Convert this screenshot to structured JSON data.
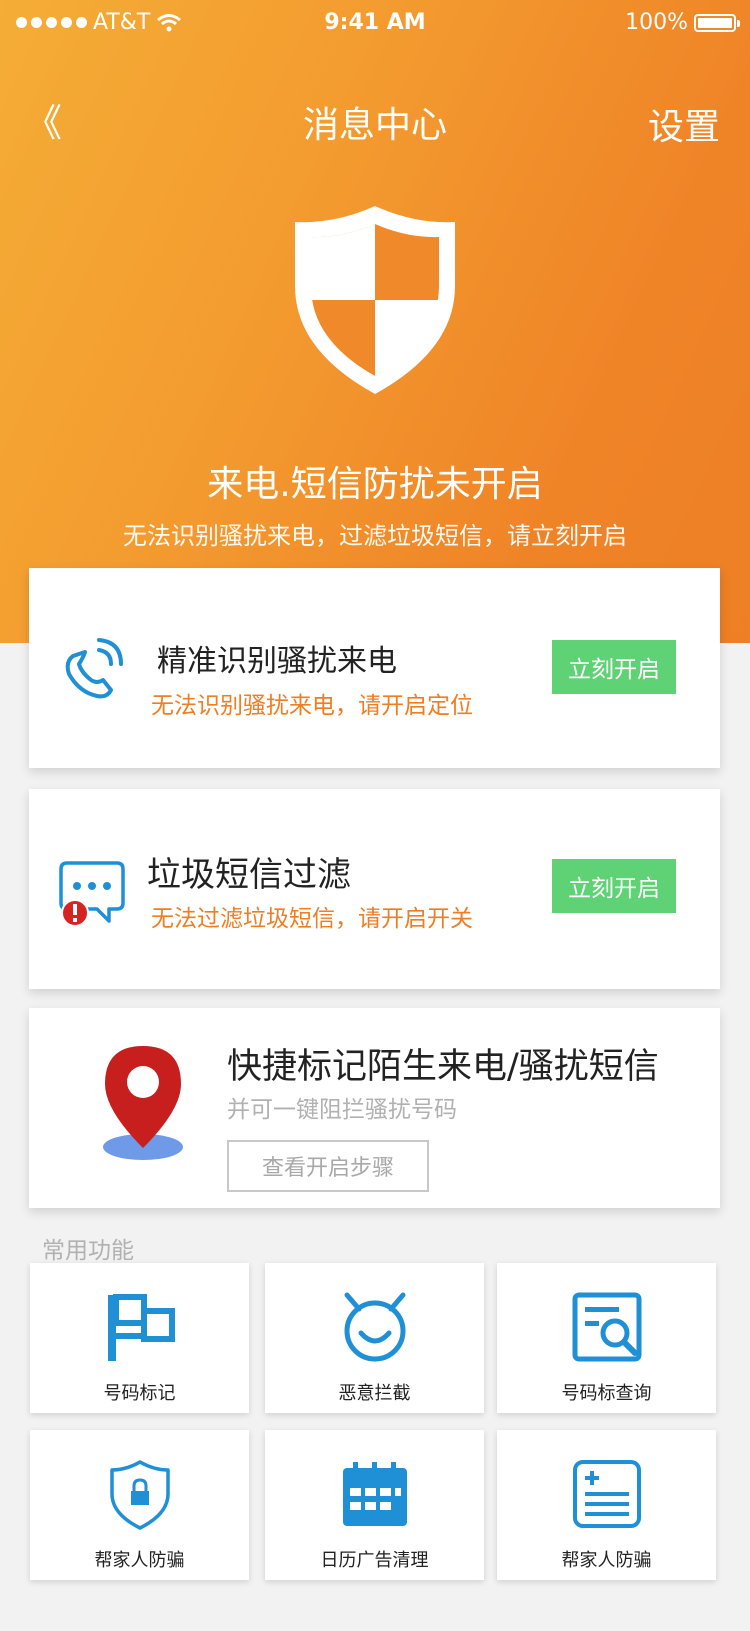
{
  "status": {
    "carrier": "AT&T",
    "time": "9:41 AM",
    "battery": "100%"
  },
  "nav": {
    "back": "《",
    "title": "消息中心",
    "settings": "设置"
  },
  "hero": {
    "title": "来电.短信防扰未开启",
    "subtitle": "无法识别骚扰来电，过滤垃圾短信，请立刻开启"
  },
  "cards": [
    {
      "title": "精准识别骚扰来电",
      "subtitle": "无法识别骚扰来电，请开启定位",
      "button": "立刻开启"
    },
    {
      "title": "垃圾短信过滤",
      "subtitle": "无法过滤垃圾短信，请开启开关",
      "button": "立刻开启"
    },
    {
      "title": "快捷标记陌生来电/骚扰短信",
      "subtitle": "并可一键阻拦骚扰号码",
      "button": "查看开启步骤"
    }
  ],
  "section_label": "常用功能",
  "tiles": [
    {
      "label": "号码标记",
      "icon": "flag-icon"
    },
    {
      "label": "恶意拦截",
      "icon": "devil-face-icon"
    },
    {
      "label": "号码标查询",
      "icon": "search-document-icon"
    },
    {
      "label": "帮家人防骗",
      "icon": "shield-lock-icon"
    },
    {
      "label": "日历广告清理",
      "icon": "calendar-icon"
    },
    {
      "label": "帮家人防骗",
      "icon": "add-list-icon"
    }
  ],
  "colors": {
    "hero_start": "#f5ad36",
    "hero_end": "#ee7f25",
    "accent_blue": "#1f8fd6",
    "button_green": "#5fd275",
    "warning_orange": "#ef7d22",
    "pin_red": "#c71e1e"
  }
}
